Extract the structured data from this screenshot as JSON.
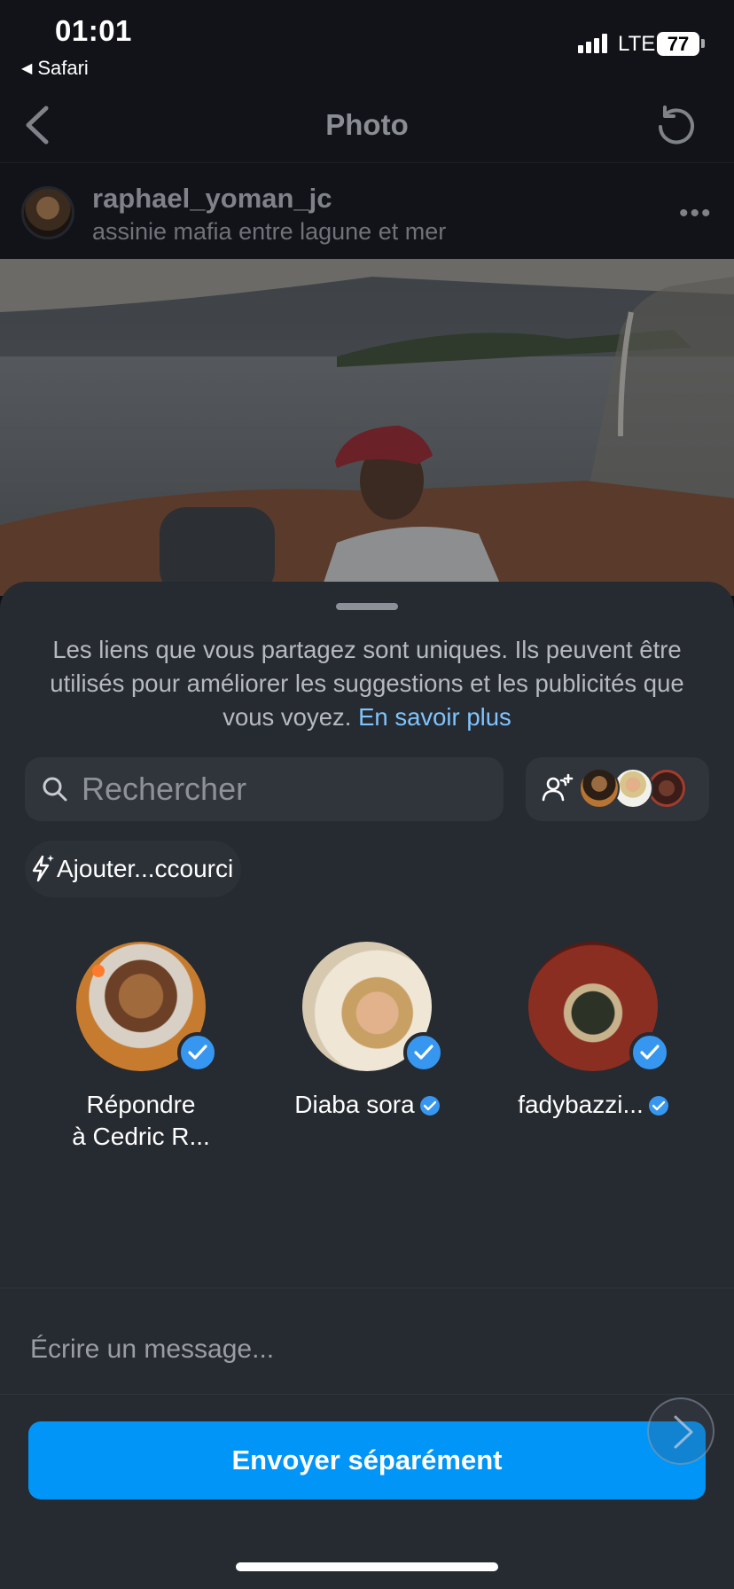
{
  "status_bar": {
    "time": "01:01",
    "back_app": "Safari",
    "network": "LTE",
    "battery": "77"
  },
  "header": {
    "title": "Photo",
    "back_icon": "chevron-left-icon",
    "refresh_icon": "refresh-icon"
  },
  "post": {
    "username": "raphael_yoman_jc",
    "location": "assinie mafia entre lagune et mer",
    "more_label": "•••"
  },
  "share_sheet": {
    "disclaimer": "Les liens que vous partagez sont uniques. Ils peuvent être utilisés pour améliorer les suggestions et les publicités que vous voyez.",
    "learn_more": "En savoir plus",
    "search_placeholder": "Rechercher",
    "shortcut_label": "Ajouter...ccourci",
    "contacts": [
      {
        "name_line1": "Répondre",
        "name_line2": "à Cedric R...",
        "verified": false,
        "selected": true
      },
      {
        "name": "Diaba sora",
        "verified": true,
        "selected": true
      },
      {
        "name": "fadybazzi...",
        "verified": true,
        "selected": true
      }
    ],
    "message_placeholder": "Écrire un message...",
    "send_label": "Envoyer séparément"
  },
  "colors": {
    "accent": "#0095f6",
    "check": "#3797f0",
    "link": "#7fc4ff",
    "sheet_bg": "#262a31"
  }
}
